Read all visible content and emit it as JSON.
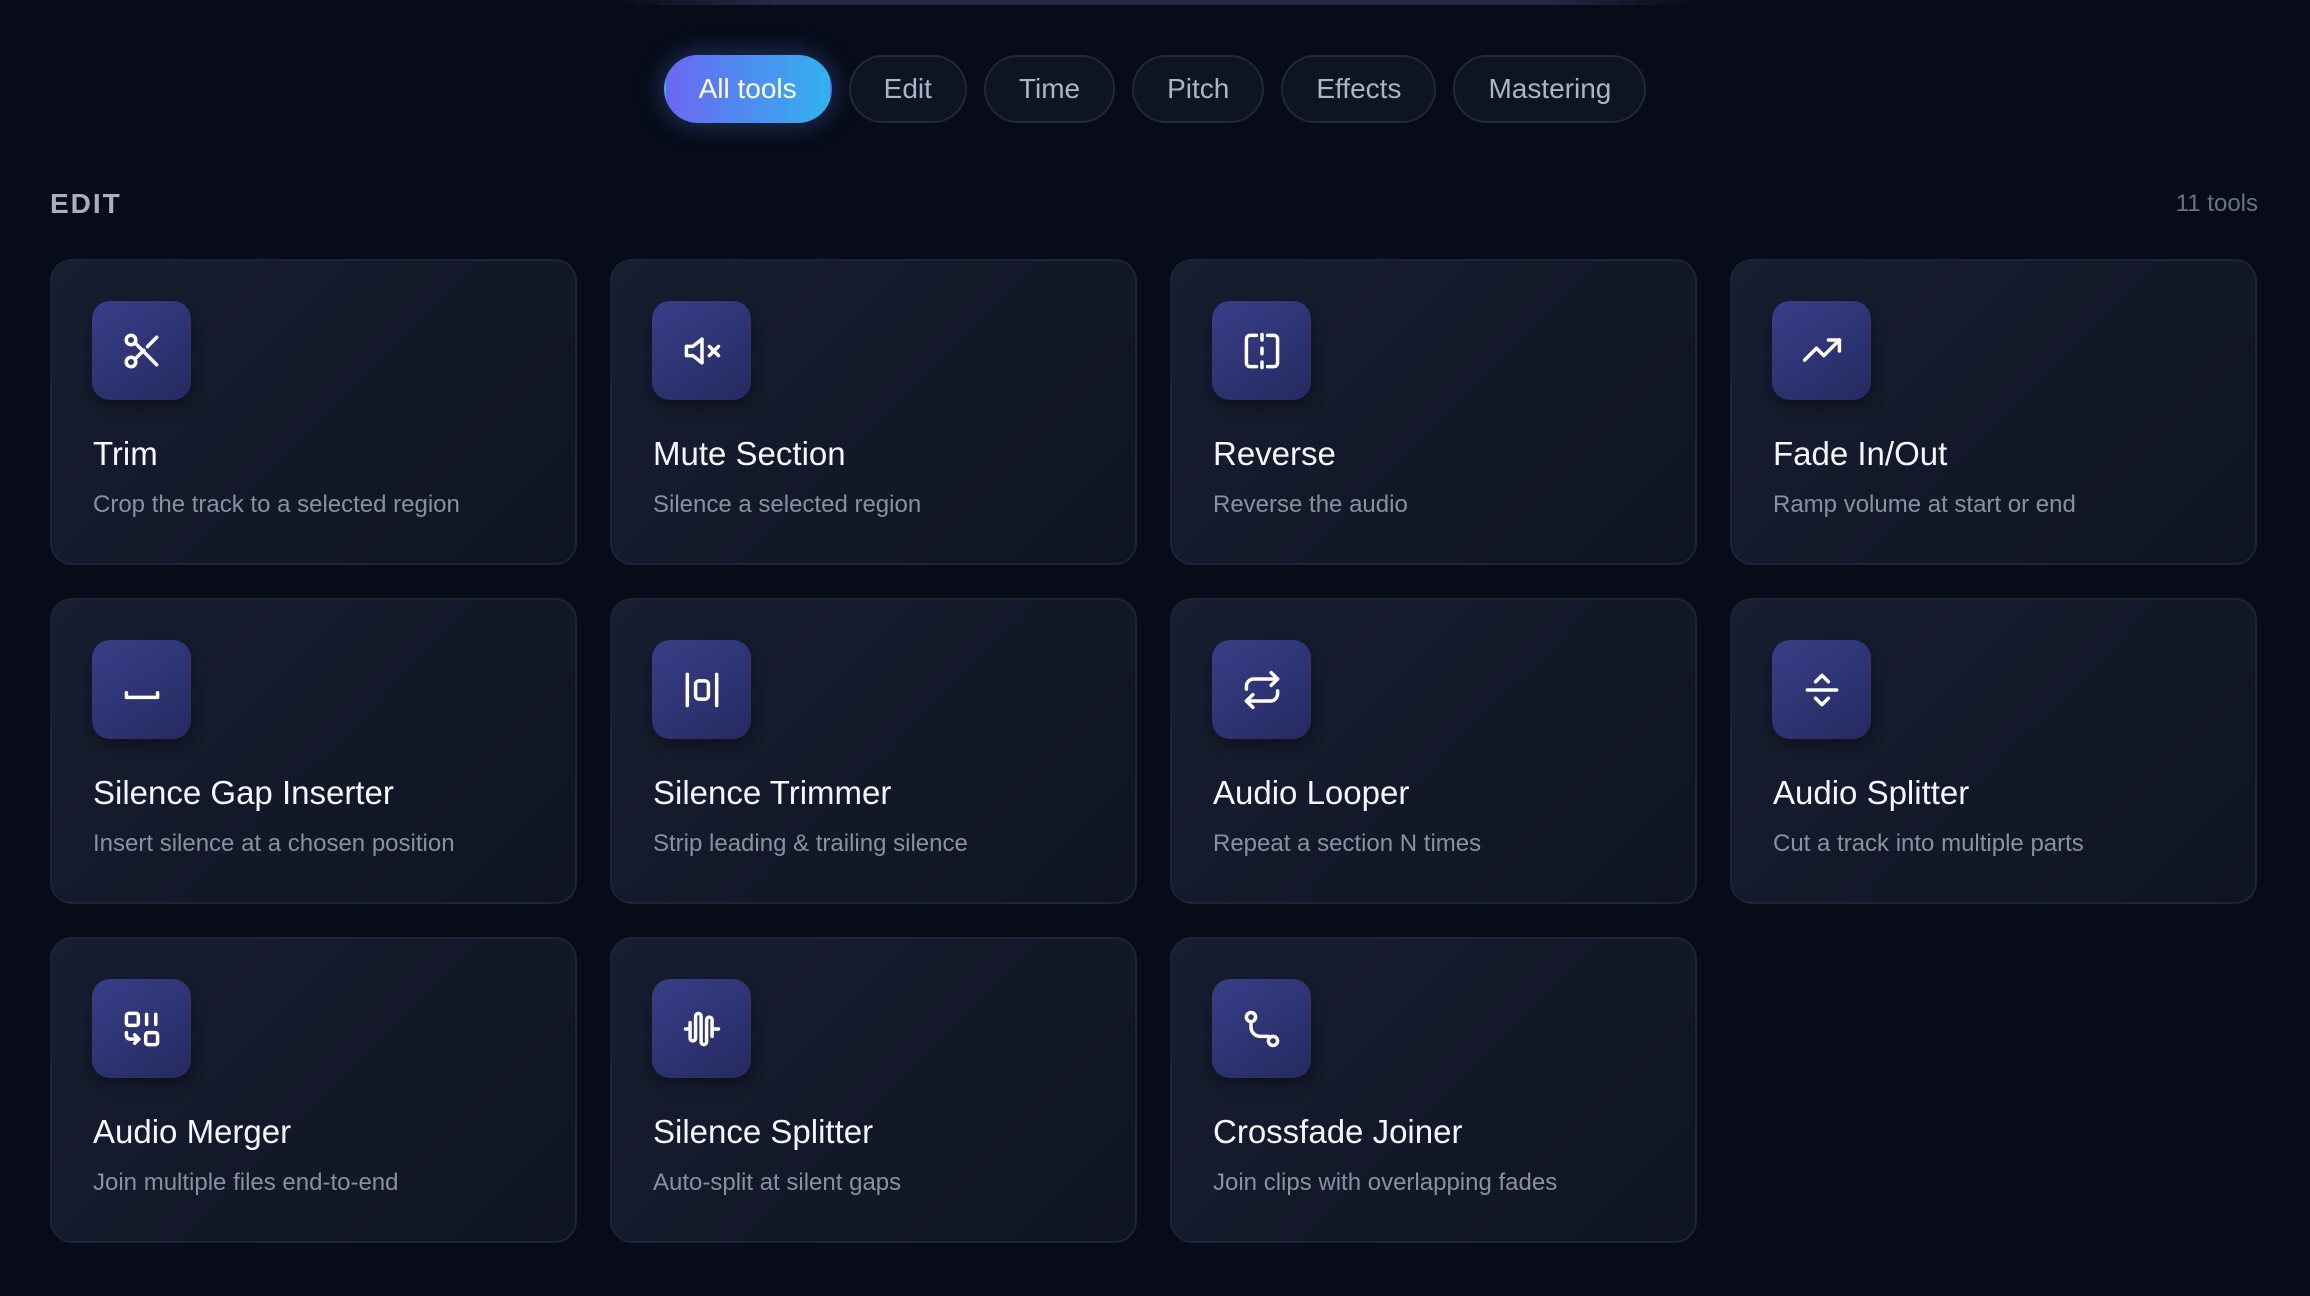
{
  "filters": {
    "items": [
      {
        "label": "All tools",
        "active": true
      },
      {
        "label": "Edit",
        "active": false
      },
      {
        "label": "Time",
        "active": false
      },
      {
        "label": "Pitch",
        "active": false
      },
      {
        "label": "Effects",
        "active": false
      },
      {
        "label": "Mastering",
        "active": false
      }
    ]
  },
  "section": {
    "title": "EDIT",
    "count": "11 tools"
  },
  "tools": [
    {
      "title": "Trim",
      "desc": "Crop the track to a selected region",
      "icon": "scissors-icon"
    },
    {
      "title": "Mute Section",
      "desc": "Silence a selected region",
      "icon": "volume-mute-icon"
    },
    {
      "title": "Reverse",
      "desc": "Reverse the audio",
      "icon": "mirror-icon"
    },
    {
      "title": "Fade In/Out",
      "desc": "Ramp volume at start or end",
      "icon": "trend-up-icon"
    },
    {
      "title": "Silence Gap Inserter",
      "desc": "Insert silence at a chosen position",
      "icon": "space-icon"
    },
    {
      "title": "Silence Trimmer",
      "desc": "Strip leading & trailing silence",
      "icon": "trim-bounds-icon"
    },
    {
      "title": "Audio Looper",
      "desc": "Repeat a section N times",
      "icon": "repeat-icon"
    },
    {
      "title": "Audio Splitter",
      "desc": "Cut a track into multiple parts",
      "icon": "split-vertical-icon"
    },
    {
      "title": "Audio Merger",
      "desc": "Join multiple files end-to-end",
      "icon": "merge-blocks-icon"
    },
    {
      "title": "Silence Splitter",
      "desc": "Auto-split at silent gaps",
      "icon": "audio-wave-icon"
    },
    {
      "title": "Crossfade Joiner",
      "desc": "Join clips with overlapping fades",
      "icon": "route-icon"
    }
  ],
  "colors": {
    "background": "#080c19",
    "card": "#151a2c",
    "icon_tile": "#30357a",
    "accent_start": "#6b67f3",
    "accent_end": "#31b2ee"
  }
}
